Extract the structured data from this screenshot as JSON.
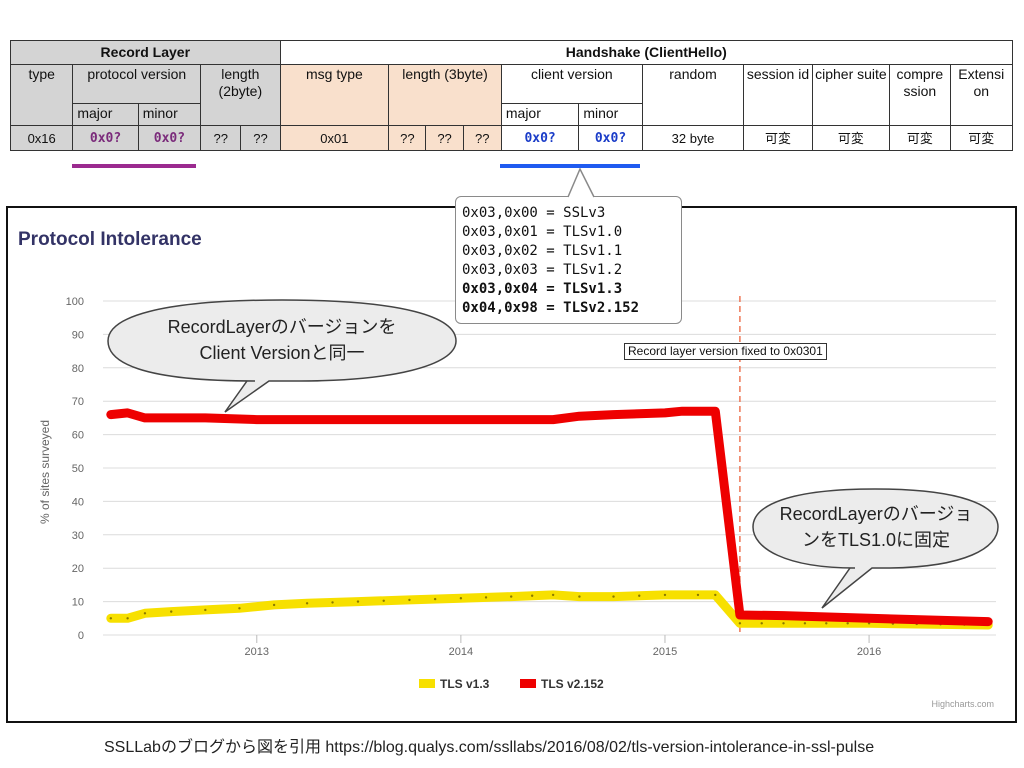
{
  "table": {
    "record_layer": "Record Layer",
    "handshake": "Handshake (ClientHello)",
    "type": "type",
    "protocol_version": "protocol version",
    "length2": "length (2byte)",
    "msg_type": "msg type",
    "length3": "length (3byte)",
    "client_version": "client version",
    "random": "random",
    "session_id": "session id",
    "cipher_suite": "cipher suite",
    "compression": "compre ssion",
    "extension": "Extensi on",
    "major": "major",
    "minor": "minor",
    "major2": "major",
    "minor2": "minor",
    "val_type": "0x16",
    "val_rec_major": "0x0?",
    "val_rec_minor": "0x0?",
    "val_len2_a": "??",
    "val_len2_b": "??",
    "val_msg_type": "0x01",
    "val_len3_a": "??",
    "val_len3_b": "??",
    "val_len3_c": "??",
    "val_cli_major": "0x0?",
    "val_cli_minor": "0x0?",
    "val_random": "32 byte",
    "val_session": "可変",
    "val_cipher": "可変",
    "val_compression": "可変",
    "val_extension": "可変"
  },
  "version_box": {
    "line1": "0x03,0x00 = SSLv3",
    "line2": "0x03,0x01 = TLSv1.0",
    "line3": "0x03,0x02 = TLSv1.1",
    "line4": "0x03,0x03 = TLSv1.2",
    "line5": "0x03,0x04 = TLSv1.3",
    "line6": "0x04,0x98 = TLSv2.152"
  },
  "bubbles": {
    "left_line1": "RecordLayerのバージョンを",
    "left_line2": "Client Versionと同一",
    "right_line1": "RecordLayerのバージョ",
    "right_line2": "ンをTLS1.0に固定"
  },
  "marker_label": "Record layer version fixed to 0x0301",
  "credit": "Highcharts.com",
  "citation": "SSLLabのブログから図を引用 https://blog.qualys.com/ssllabs/2016/08/02/tls-version-intolerance-in-ssl-pulse",
  "colors": {
    "tls13": "#f7e000",
    "tls2152": "#ee0000",
    "marker": "#ee7755",
    "purple_bar": "#9b2a8f",
    "blue_bar": "#1f5bf0"
  },
  "chart_data": {
    "type": "line",
    "title": "Protocol Intolerance",
    "xlabel": "",
    "ylabel": "% of sites surveyed",
    "ylim": [
      0,
      100
    ],
    "yticks": [
      0,
      10,
      20,
      30,
      40,
      50,
      60,
      70,
      80,
      90,
      100
    ],
    "xlim": [
      "2012-04-01",
      "2016-08-15"
    ],
    "xticks": [
      "2013",
      "2014",
      "2015",
      "2016"
    ],
    "legend_position": "bottom-center",
    "grid": true,
    "marker_date": "2015-05-15",
    "series": [
      {
        "name": "TLS v1.3",
        "points": [
          [
            "2012-04-15",
            5
          ],
          [
            "2012-05-15",
            5
          ],
          [
            "2012-06-15",
            6.5
          ],
          [
            "2012-08-01",
            7
          ],
          [
            "2012-10-01",
            7.5
          ],
          [
            "2012-12-01",
            8
          ],
          [
            "2013-02-01",
            9
          ],
          [
            "2013-04-01",
            9.5
          ],
          [
            "2013-07-01",
            10
          ],
          [
            "2013-10-01",
            10.5
          ],
          [
            "2014-01-01",
            11
          ],
          [
            "2014-04-01",
            11.5
          ],
          [
            "2014-06-15",
            12
          ],
          [
            "2014-08-01",
            11.5
          ],
          [
            "2014-10-01",
            11.5
          ],
          [
            "2015-01-01",
            12
          ],
          [
            "2015-03-01",
            12
          ],
          [
            "2015-04-01",
            12
          ],
          [
            "2015-05-15",
            3.5
          ],
          [
            "2015-08-01",
            3.5
          ],
          [
            "2016-01-01",
            3.5
          ],
          [
            "2016-08-01",
            3
          ]
        ]
      },
      {
        "name": "TLS v2.152",
        "points": [
          [
            "2012-04-15",
            66
          ],
          [
            "2012-05-15",
            66.5
          ],
          [
            "2012-06-15",
            65
          ],
          [
            "2012-10-01",
            65
          ],
          [
            "2013-01-01",
            64.5
          ],
          [
            "2013-04-01",
            64.5
          ],
          [
            "2013-07-01",
            64.5
          ],
          [
            "2013-10-01",
            64.5
          ],
          [
            "2014-01-01",
            64.5
          ],
          [
            "2014-04-01",
            64.5
          ],
          [
            "2014-06-15",
            64.5
          ],
          [
            "2014-08-01",
            65.5
          ],
          [
            "2014-10-01",
            66
          ],
          [
            "2015-01-01",
            66.5
          ],
          [
            "2015-02-01",
            67
          ],
          [
            "2015-04-01",
            67
          ],
          [
            "2015-05-15",
            6
          ],
          [
            "2015-08-01",
            5.8
          ],
          [
            "2016-01-01",
            5
          ],
          [
            "2016-08-01",
            4
          ]
        ]
      }
    ]
  }
}
